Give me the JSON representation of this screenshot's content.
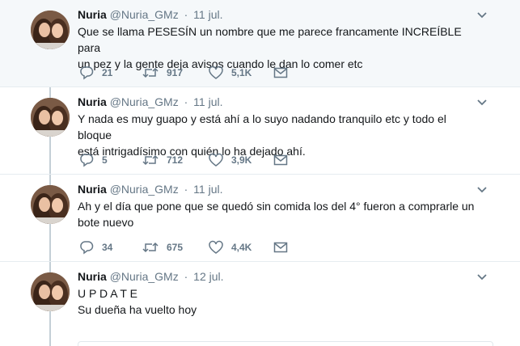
{
  "tweets": [
    {
      "name": "Nuria",
      "handle": "@Nuria_GMz",
      "separator": "·",
      "date": "11 jul.",
      "text": "Que se llama PESESÍN un nombre que me parece francamente INCREÍBLE para\nun pez y la gente deja avisos cuando le dan lo comer etc",
      "replies": "21",
      "retweets": "917",
      "likes": "5,1K",
      "highlighted": true
    },
    {
      "name": "Nuria",
      "handle": "@Nuria_GMz",
      "separator": "·",
      "date": "11 jul.",
      "text": "Y nada es muy guapo y está ahí a lo suyo nadando tranquilo etc y todo el bloque\nestá intrigadísimo con quién lo ha dejado ahí.",
      "replies": "5",
      "retweets": "712",
      "likes": "3,9K",
      "highlighted": false
    },
    {
      "name": "Nuria",
      "handle": "@Nuria_GMz",
      "separator": "·",
      "date": "11 jul.",
      "text": "Ah y el día que pone que se quedó sin comida los del 4° fueron a comprarle un\nbote nuevo",
      "replies": "34",
      "retweets": "675",
      "likes": "4,4K",
      "highlighted": false
    },
    {
      "name": "Nuria",
      "handle": "@Nuria_GMz",
      "separator": "·",
      "date": "12 jul.",
      "text": "U P D A T E\nSu dueña ha vuelto hoy",
      "highlighted": false
    }
  ],
  "icons": {
    "reply": "reply-icon",
    "retweet": "retweet-icon",
    "like": "heart-icon",
    "dm": "envelope-icon",
    "caret": "chevron-down-icon"
  },
  "colors": {
    "muted": "#657786",
    "text": "#14171a",
    "highlight_bg": "#f5f8fa",
    "thread_line": "#c4cfd6"
  }
}
